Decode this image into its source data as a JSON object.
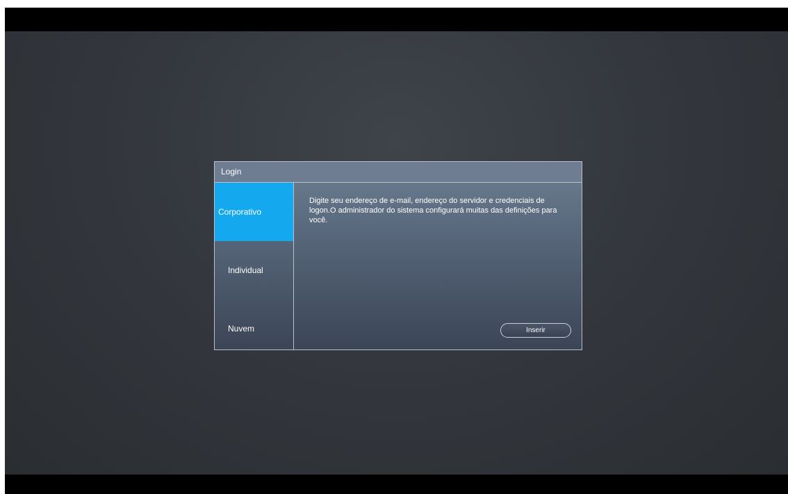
{
  "dialog": {
    "title": "Login"
  },
  "tabs": [
    {
      "label": "Corporativo",
      "active": true
    },
    {
      "label": "Individual",
      "active": false
    },
    {
      "label": "Nuvem",
      "active": false
    }
  ],
  "content": {
    "description": "Digite seu endereço de e-mail, endereço do servidor e credenciais de logon.O administrador do sistema configurará muitas das definições para você.",
    "button_label": "Inserir"
  },
  "colors": {
    "active_tab": "#14a9ee",
    "title_bar": "#6e7d91",
    "background": "#33373d"
  }
}
